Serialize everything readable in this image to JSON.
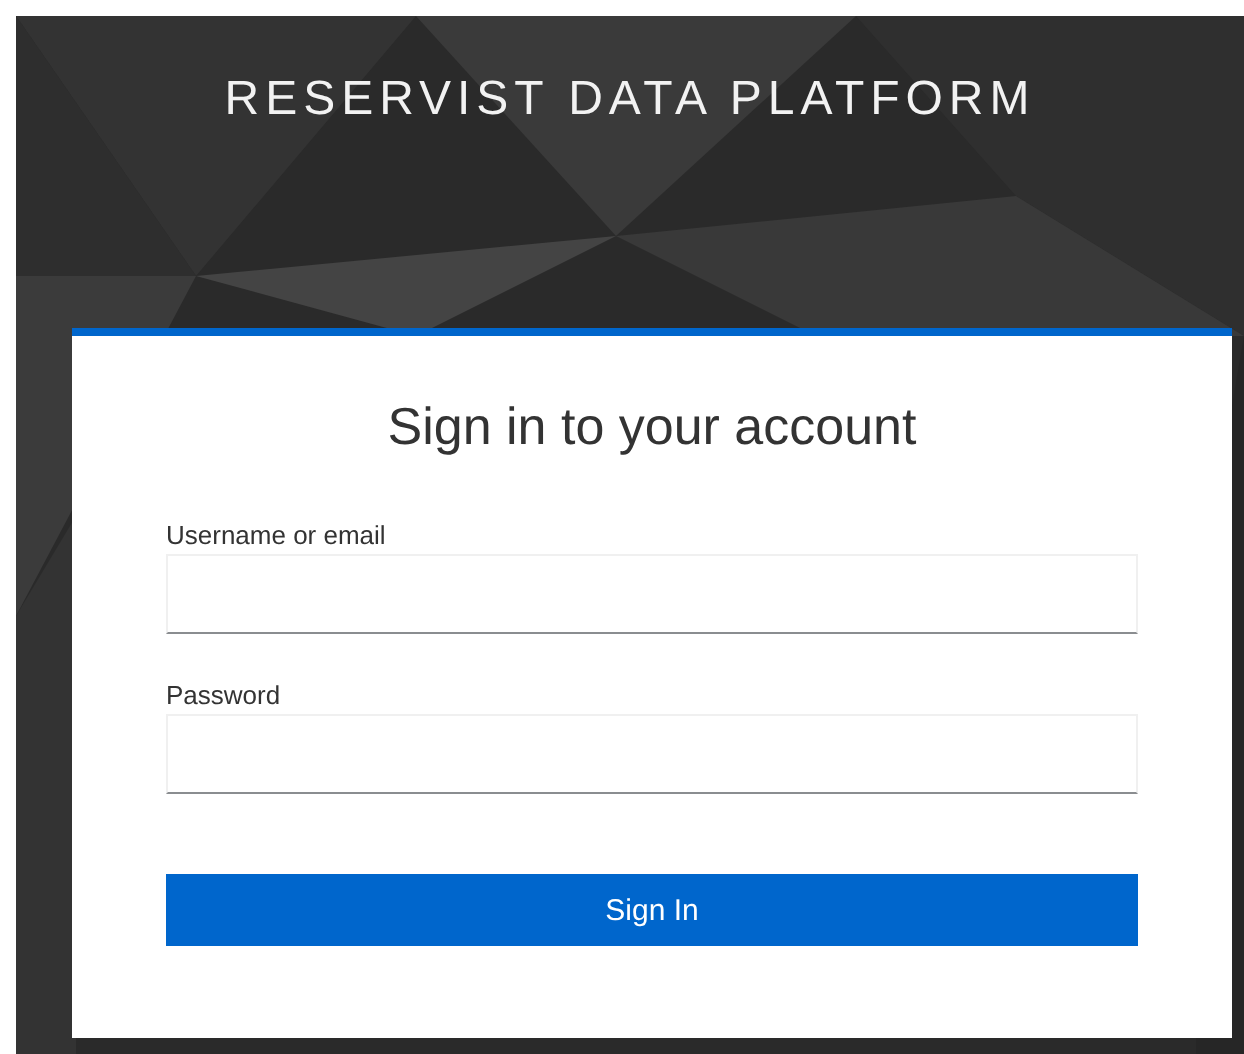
{
  "header": {
    "title": "RESERVIST DATA PLATFORM"
  },
  "login": {
    "heading": "Sign in to your account",
    "fields": [
      {
        "label": "Username or email"
      },
      {
        "label": "Password"
      }
    ],
    "submit": "Sign In"
  }
}
